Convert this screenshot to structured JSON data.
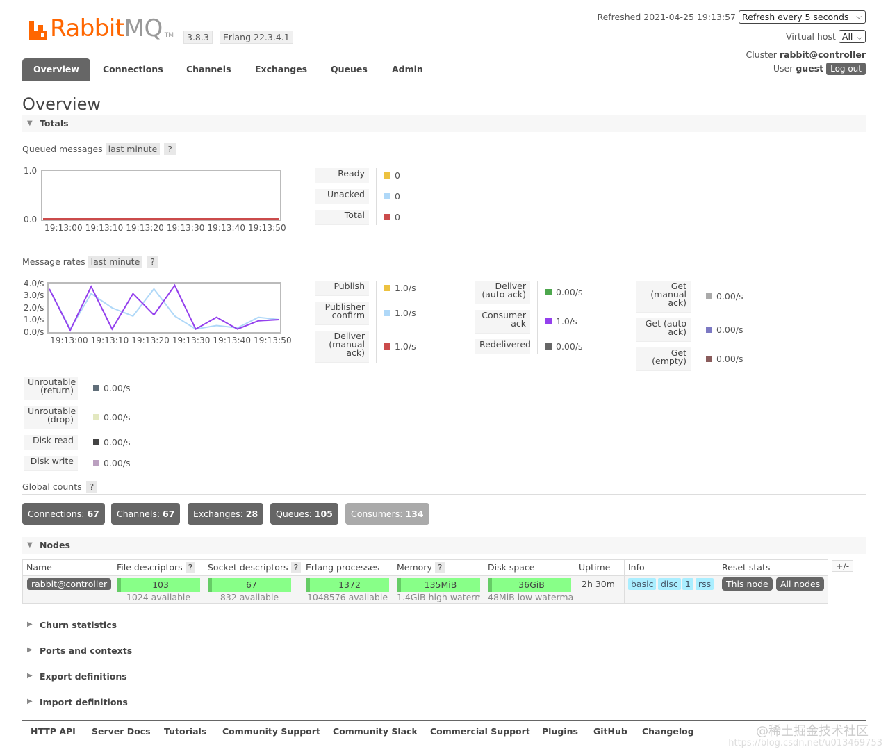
{
  "header": {
    "brand_rabbit": "Rabbit",
    "brand_mq": "MQ",
    "brand_tm": "TM",
    "version": "3.8.3",
    "erlang": "Erlang 22.3.4.1",
    "refreshed": "Refreshed 2021-04-25 19:13:57",
    "refresh_select": "Refresh every 5 seconds",
    "vhost_label": "Virtual host",
    "vhost_select": "All",
    "cluster_label": "Cluster",
    "cluster_value": "rabbit@controller",
    "user_label": "User",
    "user_value": "guest",
    "logout": "Log out"
  },
  "nav": {
    "tabs": [
      "Overview",
      "Connections",
      "Channels",
      "Exchanges",
      "Queues",
      "Admin"
    ],
    "active": "Overview"
  },
  "page_title": "Overview",
  "totals": {
    "title": "Totals",
    "queued": {
      "label": "Queued messages",
      "range": "last minute",
      "help": "?",
      "y_ticks": [
        "1.0",
        "0.0"
      ],
      "x_ticks": "19:13:00 19:13:10 19:13:20 19:13:30 19:13:40 19:13:50",
      "legend": [
        {
          "label": "Ready",
          "value": "0",
          "color": "#edc240"
        },
        {
          "label": "Unacked",
          "value": "0",
          "color": "#afd8f8"
        },
        {
          "label": "Total",
          "value": "0",
          "color": "#cb4b4b"
        }
      ]
    },
    "rates": {
      "label": "Message rates",
      "range": "last minute",
      "help": "?",
      "y_ticks": [
        "4.0/s",
        "3.0/s",
        "2.0/s",
        "1.0/s",
        "0.0/s"
      ],
      "x_ticks": "19:13:00 19:13:10 19:13:20 19:13:30 19:13:40 19:13:50",
      "legend_col1": [
        {
          "label": "Publish",
          "value": "1.0/s",
          "color": "#edc240"
        },
        {
          "label": "Publisher confirm",
          "value": "1.0/s",
          "color": "#afd8f8"
        },
        {
          "label": "Deliver (manual ack)",
          "value": "1.0/s",
          "color": "#cb4b4b"
        }
      ],
      "legend_col2": [
        {
          "label": "Deliver (auto ack)",
          "value": "0.00/s",
          "color": "#4da74d"
        },
        {
          "label": "Consumer ack",
          "value": "1.0/s",
          "color": "#9440ed"
        },
        {
          "label": "Redelivered",
          "value": "0.00/s",
          "color": "#666666"
        }
      ],
      "legend_col3": [
        {
          "label": "Get (manual ack)",
          "value": "0.00/s",
          "color": "#aaaaaa"
        },
        {
          "label": "Get (auto ack)",
          "value": "0.00/s",
          "color": "#7c79c3"
        },
        {
          "label": "Get (empty)",
          "value": "0.00/s",
          "color": "#8a5c5c"
        }
      ],
      "legend_col0": [
        {
          "label": "Unroutable (return)",
          "value": "0.00/s",
          "color": "#606e79"
        },
        {
          "label": "Unroutable (drop)",
          "value": "0.00/s",
          "color": "#e3e8c0"
        },
        {
          "label": "Disk read",
          "value": "0.00/s",
          "color": "#444444"
        },
        {
          "label": "Disk write",
          "value": "0.00/s",
          "color": "#bba0c0"
        }
      ]
    }
  },
  "chart_data": [
    {
      "type": "line",
      "ylim": [
        0,
        1
      ],
      "x": [
        "19:13:00",
        "19:13:10",
        "19:13:20",
        "19:13:30",
        "19:13:40",
        "19:13:50"
      ],
      "series": [
        {
          "name": "Ready",
          "values": [
            0,
            0,
            0,
            0,
            0,
            0
          ]
        },
        {
          "name": "Unacked",
          "values": [
            0,
            0,
            0,
            0,
            0,
            0
          ]
        },
        {
          "name": "Total",
          "values": [
            0,
            0,
            0,
            0,
            0,
            0
          ]
        }
      ]
    },
    {
      "type": "line",
      "ylim": [
        0,
        4
      ],
      "x": [
        "19:13:00",
        "19:13:05",
        "19:13:10",
        "19:13:15",
        "19:13:20",
        "19:13:25",
        "19:13:30",
        "19:13:35",
        "19:13:40",
        "19:13:45",
        "19:13:50",
        "19:13:55"
      ],
      "series": [
        {
          "name": "Publisher confirm",
          "values": [
            3.6,
            0.2,
            3.2,
            2.0,
            1.3,
            3.6,
            1.3,
            0.2,
            0.5,
            0.3,
            1.2,
            1.0
          ]
        },
        {
          "name": "Consumer ack",
          "values": [
            3.6,
            0.1,
            3.8,
            0.2,
            3.2,
            1.4,
            3.9,
            0.2,
            1.2,
            0.2,
            0.9,
            1.0
          ]
        }
      ]
    }
  ],
  "global_counts": {
    "label": "Global counts",
    "help": "?",
    "buttons": [
      {
        "label": "Connections:",
        "value": "67"
      },
      {
        "label": "Channels:",
        "value": "67"
      },
      {
        "label": "Exchanges:",
        "value": "28"
      },
      {
        "label": "Queues:",
        "value": "105"
      },
      {
        "label": "Consumers:",
        "value": "134"
      }
    ]
  },
  "nodes": {
    "title": "Nodes",
    "headers": [
      "Name",
      "File descriptors",
      "Socket descriptors",
      "Erlang processes",
      "Memory",
      "Disk space",
      "Uptime",
      "Info",
      "Reset stats"
    ],
    "help": "?",
    "plus_minus": "+/-",
    "row": {
      "name": "rabbit@controller",
      "file_desc": "103",
      "file_desc_avail": "1024 available",
      "file_desc_frac": 0.1,
      "socket_desc": "67",
      "socket_desc_avail": "832 available",
      "socket_desc_frac": 0.08,
      "erlang_proc": "1372",
      "erlang_proc_avail": "1048576 available",
      "erlang_proc_frac": 0.01,
      "memory": "135MiB",
      "memory_avail": "1.4GiB high watermark",
      "memory_frac": 0.09,
      "disk": "36GiB",
      "disk_avail": "48MiB low watermark",
      "disk_frac": 0.1,
      "uptime": "2h 30m",
      "info_tags": [
        "basic",
        "disc",
        "1",
        "rss"
      ],
      "reset_this": "This node",
      "reset_all": "All nodes"
    }
  },
  "collapsed_sections": [
    "Churn statistics",
    "Ports and contexts",
    "Export definitions",
    "Import definitions"
  ],
  "footer": {
    "links": [
      "HTTP API",
      "Server Docs",
      "Tutorials",
      "Community Support",
      "Community Slack",
      "Commercial Support",
      "Plugins",
      "GitHub",
      "Changelog"
    ]
  },
  "watermark": {
    "line1": "@稀土掘金技术社区",
    "line2": "https://blog.csdn.net/u013469753"
  }
}
